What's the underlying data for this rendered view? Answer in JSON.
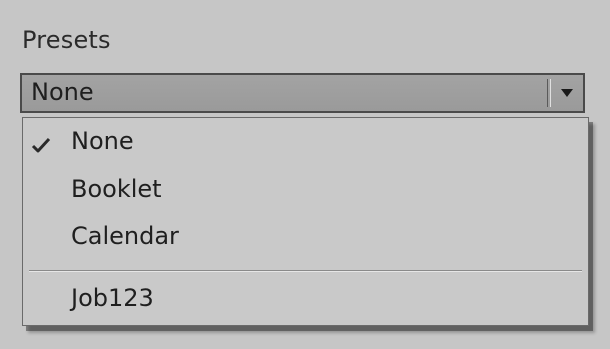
{
  "presets": {
    "label": "Presets",
    "selected": "None",
    "options": [
      {
        "label": "None",
        "checked": true
      },
      {
        "label": "Booklet",
        "checked": false
      },
      {
        "label": "Calendar",
        "checked": false
      }
    ],
    "saved_options": [
      {
        "label": "Job123",
        "checked": false
      }
    ]
  },
  "colors": {
    "panel_bg": "#c6c6c6",
    "select_bg": "#9e9e9e",
    "menu_bg": "#c9c9c9",
    "text": "#1f1f1f"
  },
  "icons": {
    "check": "check-icon",
    "dropdown_arrow": "triangle-down-icon"
  }
}
